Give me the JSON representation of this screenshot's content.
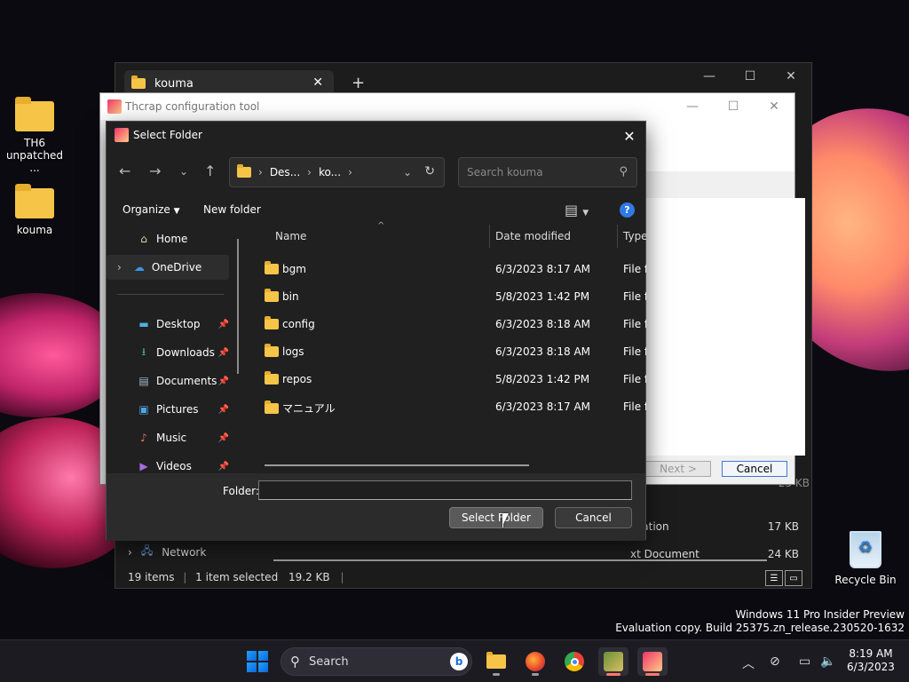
{
  "desktop": {
    "icons": [
      {
        "label_line1": "TH6",
        "label_line2": "unpatched ..."
      },
      {
        "label_line1": "kouma",
        "label_line2": ""
      },
      {
        "label_line1": "Recycle Bin",
        "label_line2": ""
      }
    ],
    "watermark": {
      "line1": "Windows 11 Pro Insider Preview",
      "line2": "Evaluation copy. Build 25375.zn_release.230520-1632"
    }
  },
  "explorer": {
    "tab_title": "kouma",
    "new_tab": "+",
    "rows": [
      {
        "type": "lication",
        "size": "17 KB"
      },
      {
        "type": "xt Document",
        "size": "24 KB"
      }
    ],
    "partial_size": "25 KB",
    "network_label": "Network",
    "status": {
      "count": "19 items",
      "selected": "1 item selected",
      "size": "19.2 KB"
    }
  },
  "thcrap": {
    "title": "Thcrap configuration tool",
    "next_label": "Next >",
    "cancel_label": "Cancel"
  },
  "dialog": {
    "title": "Select Folder",
    "address": {
      "crumb1": "Des...",
      "crumb2": "ko..."
    },
    "search_placeholder": "Search kouma",
    "toolbar": {
      "organize": "Organize",
      "new_folder": "New folder",
      "help": "?"
    },
    "sidebar": {
      "home": "Home",
      "onedrive": "OneDrive",
      "desktop": "Desktop",
      "downloads": "Downloads",
      "documents": "Documents",
      "pictures": "Pictures",
      "music": "Music",
      "videos": "Videos"
    },
    "columns": {
      "name": "Name",
      "date": "Date modified",
      "type": "Type"
    },
    "files": [
      {
        "name": "bgm",
        "date": "6/3/2023 8:17 AM",
        "type": "File fo"
      },
      {
        "name": "bin",
        "date": "5/8/2023 1:42 PM",
        "type": "File fo"
      },
      {
        "name": "config",
        "date": "6/3/2023 8:18 AM",
        "type": "File fo"
      },
      {
        "name": "logs",
        "date": "6/3/2023 8:18 AM",
        "type": "File fo"
      },
      {
        "name": "repos",
        "date": "5/8/2023 1:42 PM",
        "type": "File fo"
      },
      {
        "name": "マニュアル",
        "date": "6/3/2023 8:17 AM",
        "type": "File fo"
      }
    ],
    "folder_label": "Folder:",
    "folder_value": "",
    "select_button": "Select Folder",
    "cancel_button": "Cancel"
  },
  "taskbar": {
    "search_label": "Search",
    "time": "8:19 AM",
    "date": "6/3/2023"
  },
  "colors": {
    "accent": "#2f7ae5",
    "folder": "#f6c548",
    "dialog_bg": "#202020"
  }
}
